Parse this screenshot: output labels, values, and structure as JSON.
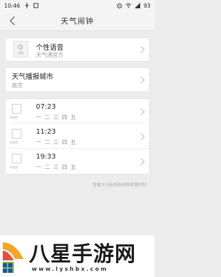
{
  "status_bar": {
    "time": "10:46",
    "icons_left": [
      "usb-icon",
      "notification-icon"
    ],
    "icons_right": [
      "alarm-icon",
      "wifi-icon",
      "signal-icon"
    ],
    "battery": "93"
  },
  "header": {
    "title": "天气闹钟",
    "back_icon": "back-arrow-icon"
  },
  "voice": {
    "icon_label": "试听",
    "name": "个性语音",
    "sub": "天气通官方"
  },
  "city": {
    "label": "天气播报城市",
    "value": "南京"
  },
  "alarms": [
    {
      "time": "07:23",
      "days": "一 二 三 四 五",
      "checkbox_label": "未启用"
    },
    {
      "time": "11:23",
      "days": "一 二 三 四 五",
      "checkbox_label": "未启用"
    },
    {
      "time": "19:33",
      "days": "一 二 三 四 五",
      "checkbox_label": "未启用"
    }
  ],
  "hint": "音量大小由系统闹钟音量控制",
  "watermark": {
    "text": "八星手游网",
    "url": "www.lyshbx.com"
  },
  "colors": {
    "background": "#ececec",
    "card": "#ffffff",
    "secondary_text": "#999999"
  }
}
